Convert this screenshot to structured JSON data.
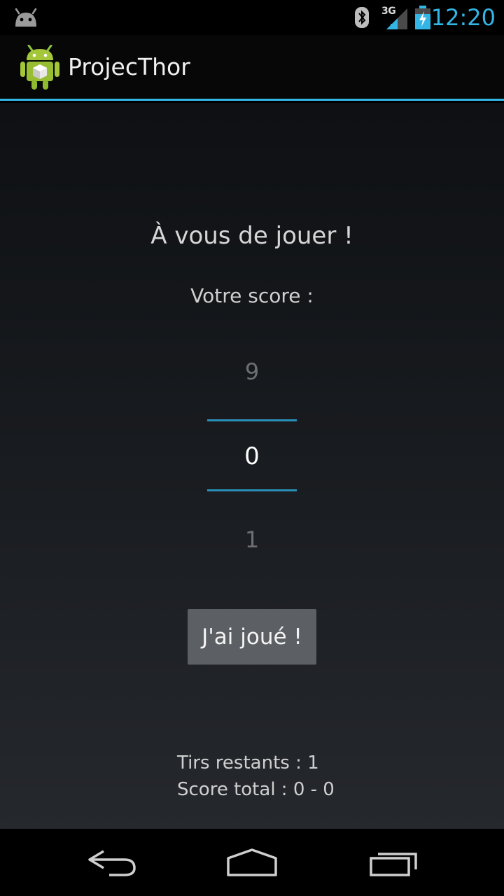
{
  "status_bar": {
    "network_label": "3G",
    "time": "12:20",
    "accent_color": "#33b5e5",
    "icons": [
      "android-robot-icon",
      "bluetooth-icon",
      "signal-icon",
      "battery-charging-icon"
    ]
  },
  "action_bar": {
    "title": "ProjecThor",
    "icon": "android-app-icon"
  },
  "main": {
    "prompt": "À vous de jouer !",
    "score_label": "Votre score :",
    "picker": {
      "previous": "9",
      "current": "0",
      "next": "1"
    },
    "play_button": "J'ai joué !",
    "shots_remaining": "Tirs restants : 1",
    "total_score": "Score total : 0 - 0"
  },
  "nav_bar": {
    "icons": [
      "back-icon",
      "home-icon",
      "recents-icon"
    ]
  }
}
